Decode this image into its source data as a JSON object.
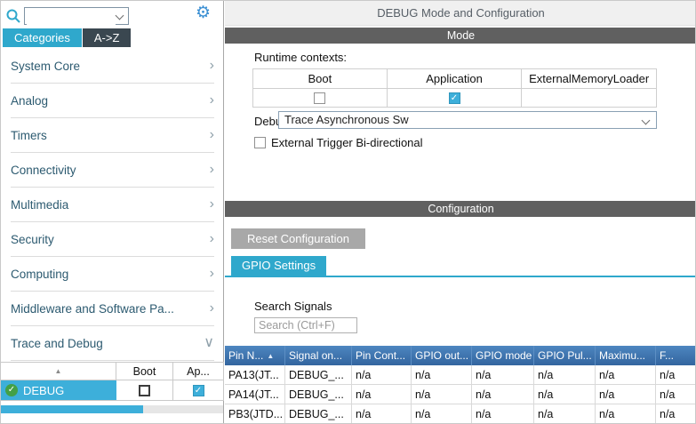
{
  "icons": {
    "gear": "⚙",
    "check": "✓",
    "sort_asc": "▲"
  },
  "left_panel": {
    "search_value": "",
    "tabs": {
      "categories": "Categories",
      "az": "A->Z"
    },
    "categories": [
      {
        "label": "System Core",
        "chevron": "›"
      },
      {
        "label": "Analog",
        "chevron": "›"
      },
      {
        "label": "Timers",
        "chevron": "›"
      },
      {
        "label": "Connectivity",
        "chevron": "›"
      },
      {
        "label": "Multimedia",
        "chevron": "›"
      },
      {
        "label": "Security",
        "chevron": "›"
      },
      {
        "label": "Computing",
        "chevron": "›"
      },
      {
        "label": "Middleware and Software Pa...",
        "chevron": "›"
      },
      {
        "label": "Trace and Debug",
        "chevron": "∨"
      }
    ],
    "peripheral_table": {
      "headers": {
        "boot": "Boot",
        "app": "Ap..."
      },
      "row": {
        "name": "DEBUG"
      }
    }
  },
  "main": {
    "title": "DEBUG Mode and Configuration",
    "mode": {
      "header": "Mode",
      "runtime_contexts_label": "Runtime contexts:",
      "context_headers": [
        "Boot",
        "Application",
        "ExternalMemoryLoader"
      ],
      "debug_label": "Debug",
      "debug_value": "Trace Asynchronous Sw",
      "external_trigger_label": "External Trigger Bi-directional"
    },
    "config": {
      "header": "Configuration",
      "reset_button": "Reset Configuration",
      "gpio_tab": "GPIO Settings",
      "search_label": "Search Signals",
      "search_placeholder": "Search (Ctrl+F)",
      "table": {
        "headers": [
          "Pin N...",
          "Signal on...",
          "Pin Cont...",
          "GPIO out...",
          "GPIO mode",
          "GPIO Pul...",
          "Maximu...",
          "F..."
        ],
        "rows": [
          [
            "PA13(JT...",
            "DEBUG_...",
            "n/a",
            "n/a",
            "n/a",
            "n/a",
            "n/a",
            "n/a"
          ],
          [
            "PA14(JT...",
            "DEBUG_...",
            "n/a",
            "n/a",
            "n/a",
            "n/a",
            "n/a",
            "n/a"
          ],
          [
            "PB3(JTD...",
            "DEBUG_...",
            "n/a",
            "n/a",
            "n/a",
            "n/a",
            "n/a",
            "n/a"
          ]
        ]
      }
    }
  },
  "colors": {
    "accent_teal": "#2fa8cc",
    "selection_blue": "#3dafda",
    "section_gray": "#606060",
    "table_header_blue": "#3a6fb0",
    "dark_tab": "#3a4750",
    "check_green": "#43a047"
  }
}
